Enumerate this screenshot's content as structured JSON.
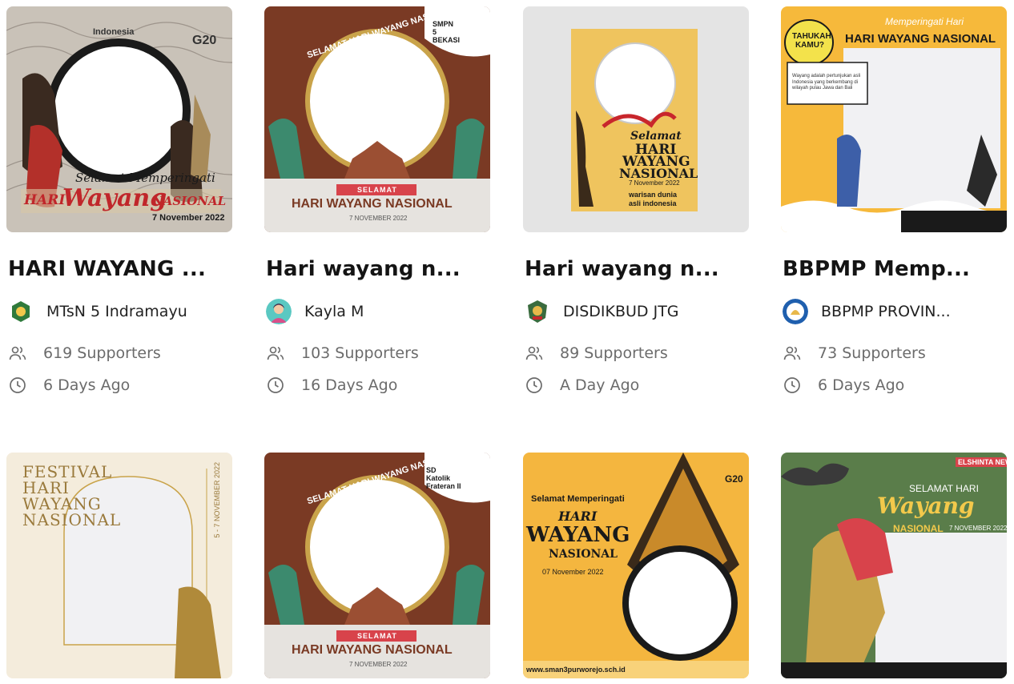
{
  "cards": [
    {
      "title": "HARI WAYANG ...",
      "creator": "MTsN 5 Indramayu",
      "supporters": "619 Supporters",
      "time": "6 Days Ago",
      "thumb": {
        "top_text": "Selamat Memperingati",
        "line1": "HARI",
        "line2": "Wayang",
        "line3": "NASIONAL",
        "date": "7 November 2022",
        "badge1": "G20",
        "badge2": "Indonesia"
      }
    },
    {
      "title": "Hari wayang n...",
      "creator": "Kayla M",
      "supporters": "103 Supporters",
      "time": "16 Days Ago",
      "thumb": {
        "arc": "SELAMAT HARI WAYANG NASIONAL 2022",
        "ribbon": "SELAMAT",
        "line1": "HARI WAYANG NASIONAL",
        "date": "7 NOVEMBER 2022",
        "school": "SMPN 5 BEKASI"
      }
    },
    {
      "title": "Hari wayang n...",
      "creator": "DISDIKBUD JTG",
      "supporters": "89 Supporters",
      "time": "A Day Ago",
      "thumb": {
        "line0": "Selamat",
        "line1": "HARI",
        "line2": "WAYANG",
        "line3": "NASIONAL",
        "date": "7 November 2022",
        "footer1": "warisan dunia",
        "footer2": "asli indonesia"
      }
    },
    {
      "title": "BBPMP Memp...",
      "creator": "BBPMP PROVIN...",
      "supporters": "73 Supporters",
      "time": "6 Days Ago",
      "thumb": {
        "bubble": "TAHUKAH KAMU?",
        "top_script": "Memperingati Hari",
        "line1": "HARI WAYANG NASIONAL",
        "info": "Wayang adalah pertunjukan asli Indonesia yang berkembang di wilayah pulau Jawa dan Bali"
      }
    },
    {
      "title": "",
      "creator": "",
      "supporters": "",
      "time": "",
      "thumb": {
        "line1": "FESTIVAL",
        "line2": "HARI",
        "line3": "WAYANG",
        "line4": "NASIONAL",
        "date": "5 - 7 NOVEMBER 2022"
      }
    },
    {
      "title": "",
      "creator": "",
      "supporters": "",
      "time": "",
      "thumb": {
        "arc": "SELAMAT HARI WAYANG NASIONAL 2022",
        "ribbon": "SELAMAT",
        "line1": "HARI WAYANG NASIONAL",
        "date": "7 NOVEMBER 2022",
        "school": "SD Katolik Frateran II"
      }
    },
    {
      "title": "",
      "creator": "",
      "supporters": "",
      "time": "",
      "thumb": {
        "line0": "Selamat Memperingati",
        "line1": "HARI",
        "line2": "WAYANG",
        "line3": "NASIONAL",
        "date": "07 November 2022",
        "url": "www.sman3purworejo.sch.id",
        "badge1": "G20"
      }
    },
    {
      "title": "",
      "creator": "",
      "supporters": "",
      "time": "",
      "thumb": {
        "brand": "ELSHINTA NEWS",
        "top_script": "SELAMAT HARI",
        "line1": "Wayang",
        "line2": "NASIONAL",
        "date": "7 NOVEMBER 2022"
      }
    }
  ],
  "icons": {
    "supporters": "users-icon",
    "time": "clock-icon"
  },
  "colors": {
    "title": "#141414",
    "meta_text": "#6b6b6b",
    "brown_frame": "#7a3a24",
    "cream": "#f4ecdc",
    "yellow_frame": "#f6b93b",
    "green_frame": "#5a7d4a"
  }
}
